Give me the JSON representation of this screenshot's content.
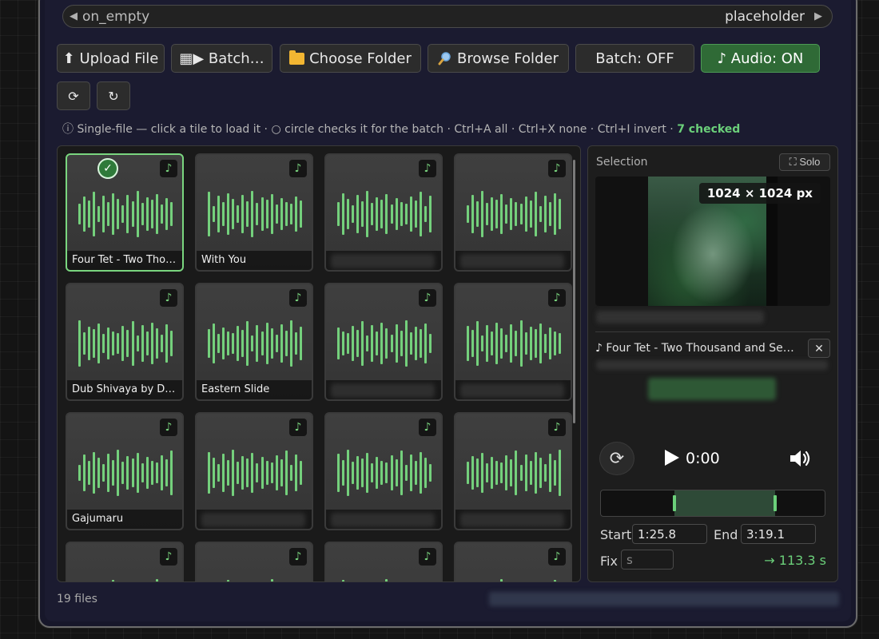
{
  "widget": {
    "left_value": "on_empty",
    "right_value": "placeholder"
  },
  "toolbar": {
    "upload_label": "⬆ Upload File",
    "batch_label": "▦▶ Batch…",
    "choose_folder_label": "Choose Folder",
    "browse_folder_label": "Browse Folder",
    "batch_toggle_label": "Batch: OFF",
    "audio_toggle_label": "♪ Audio: ON",
    "refresh_glyph": "⟳",
    "reload_glyph": "↻"
  },
  "hint": {
    "text": "ⓘ Single-file — click a tile to load it · ○ circle checks it for the batch · Ctrl+A all · Ctrl+X none · Ctrl+I invert · ",
    "checked": "7 checked"
  },
  "tiles": [
    {
      "label": "Four Tet - Two Tho…",
      "selected": true,
      "checked": true
    },
    {
      "label": "With You",
      "selected": false
    },
    {
      "label": "",
      "selected": false
    },
    {
      "label": "",
      "selected": false
    },
    {
      "label": "Dub Shivaya by Du…",
      "selected": false
    },
    {
      "label": "Eastern Slide",
      "selected": false
    },
    {
      "label": "",
      "selected": false
    },
    {
      "label": "",
      "selected": false
    },
    {
      "label": "Gajumaru",
      "selected": false
    },
    {
      "label": "",
      "selected": false
    },
    {
      "label": "",
      "selected": false
    },
    {
      "label": "",
      "selected": false
    },
    {
      "label": "",
      "selected": false
    },
    {
      "label": "",
      "selected": false
    },
    {
      "label": "",
      "selected": false
    },
    {
      "label": "",
      "selected": false
    }
  ],
  "selection": {
    "title": "Selection",
    "solo_label": "⛶ Solo",
    "resolution": "1024 × 1024 px",
    "track_name": "♪ Four Tet - Two Thousand and Sev…",
    "close_glyph": "✕"
  },
  "player": {
    "time": "0:00",
    "loop_glyph": "⟳"
  },
  "trim": {
    "start_label": "Start",
    "start_value": "1:25.8",
    "end_label": "End",
    "end_value": "3:19.1",
    "fix_label": "Fix",
    "fix_placeholder": "s",
    "duration": "→ 113.3 s",
    "selection_start_fraction": 0.33,
    "selection_end_fraction": 0.78
  },
  "footer": {
    "file_count": "19 files"
  },
  "colors": {
    "accent_green": "#6bd07a",
    "audio_on_bg": "#2f6a36"
  }
}
